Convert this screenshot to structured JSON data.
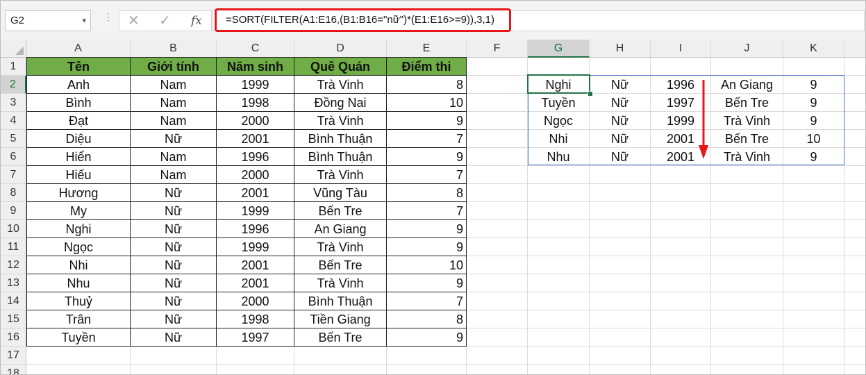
{
  "name_box": {
    "value": "G2"
  },
  "formula_bar": {
    "cancel_symbol": "✕",
    "enter_symbol": "✓",
    "fx_label": "fx",
    "formula": "=SORT(FILTER(A1:E16,(B1:B16=\"nữ\")*(E1:E16>=9)),3,1)",
    "highlight_color": "#e6161b"
  },
  "columns": [
    "A",
    "B",
    "C",
    "D",
    "E",
    "F",
    "G",
    "H",
    "I",
    "J",
    "K"
  ],
  "rows": [
    "1",
    "2",
    "3",
    "4",
    "5",
    "6",
    "7",
    "8",
    "9",
    "10",
    "11",
    "12",
    "13",
    "14",
    "15",
    "16",
    "17",
    "18"
  ],
  "selected_column": "G",
  "selected_row": "2",
  "source_table": {
    "header_color": "#70ad47",
    "headers": [
      "Tên",
      "Giới tính",
      "Năm sinh",
      "Quê Quán",
      "Điểm thi"
    ],
    "rows": [
      [
        "Anh",
        "Nam",
        "1999",
        "Trà Vinh",
        "8"
      ],
      [
        "Bình",
        "Nam",
        "1998",
        "Đồng Nai",
        "10"
      ],
      [
        "Đạt",
        "Nam",
        "2000",
        "Trà Vinh",
        "9"
      ],
      [
        "Diệu",
        "Nữ",
        "2001",
        "Bình Thuận",
        "7"
      ],
      [
        "Hiển",
        "Nam",
        "1996",
        "Bình Thuận",
        "9"
      ],
      [
        "Hiếu",
        "Nam",
        "2000",
        "Trà Vinh",
        "7"
      ],
      [
        "Hương",
        "Nữ",
        "2001",
        "Vũng Tàu",
        "8"
      ],
      [
        "My",
        "Nữ",
        "1999",
        "Bến Tre",
        "7"
      ],
      [
        "Nghi",
        "Nữ",
        "1996",
        "An Giang",
        "9"
      ],
      [
        "Ngọc",
        "Nữ",
        "1999",
        "Trà Vinh",
        "9"
      ],
      [
        "Nhi",
        "Nữ",
        "2001",
        "Bến Tre",
        "10"
      ],
      [
        "Nhu",
        "Nữ",
        "2001",
        "Trà Vinh",
        "9"
      ],
      [
        "Thuỷ",
        "Nữ",
        "2000",
        "Bình Thuận",
        "7"
      ],
      [
        "Trân",
        "Nữ",
        "1998",
        "Tiền Giang",
        "8"
      ],
      [
        "Tuyền",
        "Nữ",
        "1997",
        "Bến Tre",
        "9"
      ]
    ]
  },
  "result_table": {
    "rows": [
      [
        "Nghi",
        "Nữ",
        "1996",
        "An Giang",
        "9"
      ],
      [
        "Tuyền",
        "Nữ",
        "1997",
        "Bến Tre",
        "9"
      ],
      [
        "Ngọc",
        "Nữ",
        "1999",
        "Trà Vinh",
        "9"
      ],
      [
        "Nhi",
        "Nữ",
        "2001",
        "Bến Tre",
        "10"
      ],
      [
        "Nhu",
        "Nữ",
        "2001",
        "Trà Vinh",
        "9"
      ]
    ]
  },
  "annotation": {
    "arrow_color": "#e6161b",
    "arrow_direction": "down"
  }
}
